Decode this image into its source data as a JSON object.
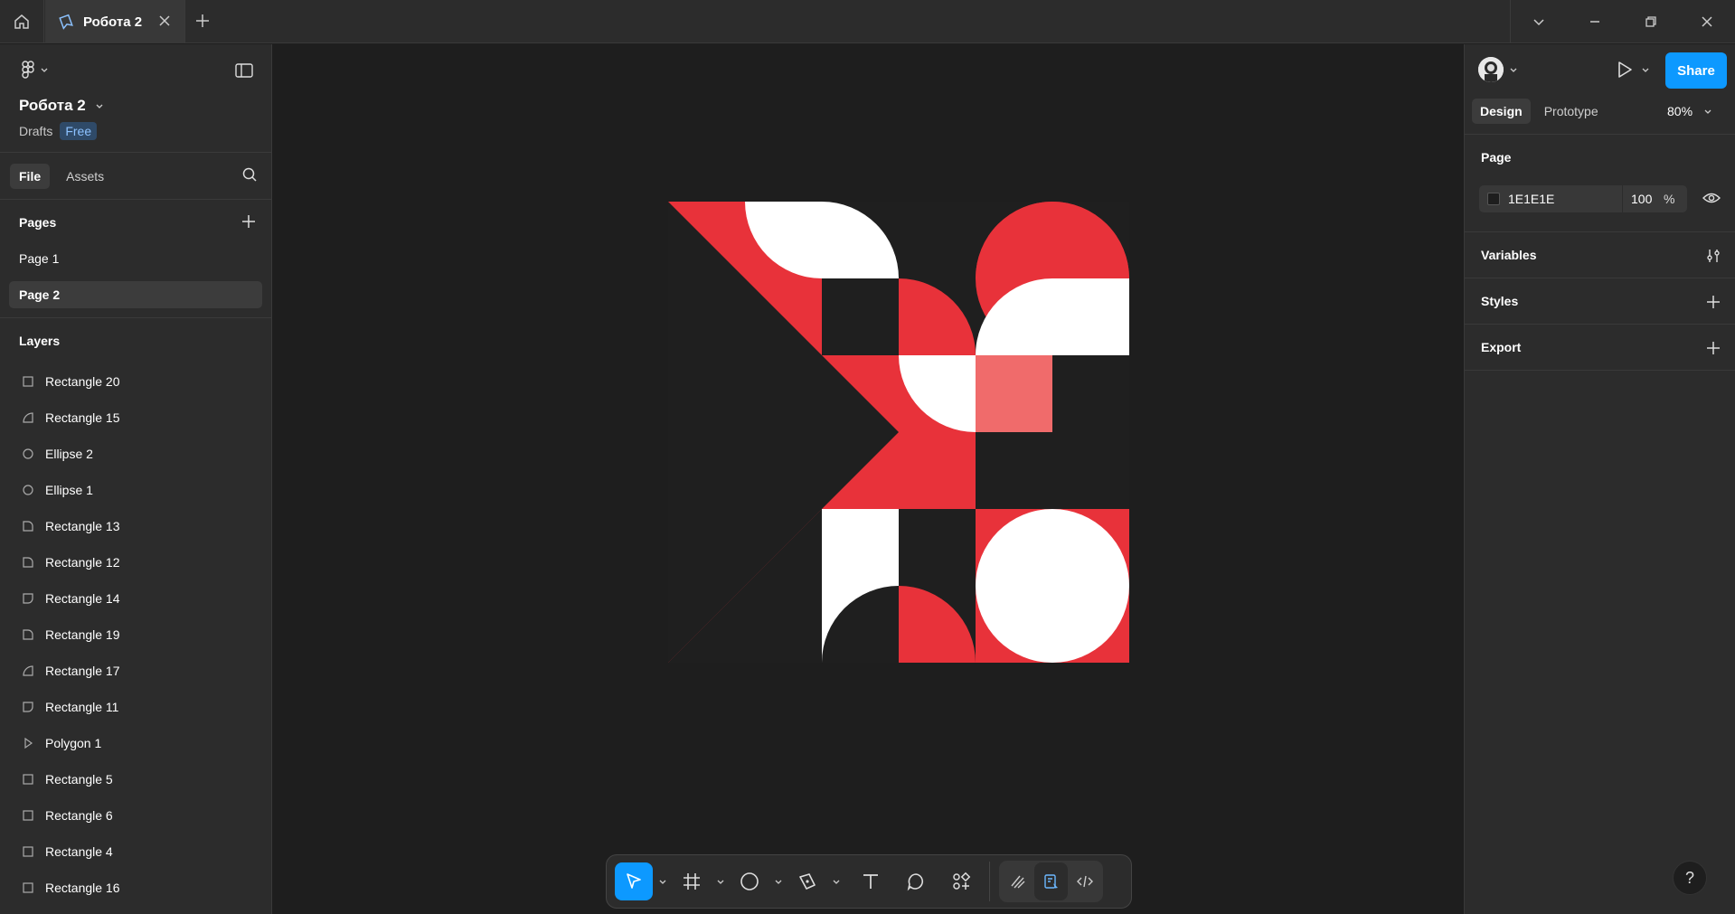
{
  "titlebar": {
    "tab_title": "Робота 2"
  },
  "left_panel": {
    "file_name": "Робота 2",
    "location": "Drafts",
    "plan_badge": "Free",
    "tabs": [
      {
        "label": "File",
        "active": true
      },
      {
        "label": "Assets",
        "active": false
      }
    ],
    "pages_header": "Pages",
    "pages": [
      {
        "label": "Page 1",
        "active": false
      },
      {
        "label": "Page 2",
        "active": true
      }
    ],
    "layers_header": "Layers",
    "layers": [
      {
        "label": "Rectangle 20",
        "icon": "rect-icon"
      },
      {
        "label": "Rectangle 15",
        "icon": "curve-shape-icon"
      },
      {
        "label": "Ellipse 2",
        "icon": "ellipse-icon"
      },
      {
        "label": "Ellipse 1",
        "icon": "ellipse-icon"
      },
      {
        "label": "Rectangle 13",
        "icon": "corner-shape-icon"
      },
      {
        "label": "Rectangle 12",
        "icon": "corner-shape-icon"
      },
      {
        "label": "Rectangle 14",
        "icon": "corner-shape-flipped-icon"
      },
      {
        "label": "Rectangle 19",
        "icon": "corner-shape-icon"
      },
      {
        "label": "Rectangle 17",
        "icon": "curve-shape-icon"
      },
      {
        "label": "Rectangle 11",
        "icon": "corner-shape-flipped-icon"
      },
      {
        "label": "Polygon 1",
        "icon": "triangle-icon"
      },
      {
        "label": "Rectangle 5",
        "icon": "rect-icon"
      },
      {
        "label": "Rectangle 6",
        "icon": "rect-icon"
      },
      {
        "label": "Rectangle 4",
        "icon": "rect-icon"
      },
      {
        "label": "Rectangle 16",
        "icon": "rect-icon"
      }
    ]
  },
  "right_panel": {
    "share_label": "Share",
    "tabs": [
      {
        "label": "Design",
        "active": true
      },
      {
        "label": "Prototype",
        "active": false
      }
    ],
    "zoom": "80%",
    "page_section": {
      "header": "Page",
      "fill_hex": "1E1E1E",
      "opacity": "100",
      "opacity_unit": "%"
    },
    "variables_label": "Variables",
    "styles_label": "Styles",
    "export_label": "Export",
    "help_label": "?"
  },
  "colors": {
    "accent": "#0d99ff",
    "artwork_red": "#e8323a",
    "artwork_light_red": "#f06b6b",
    "artwork_white": "#ffffff",
    "artwork_bg": "#1e1e1e"
  },
  "toolbar": {
    "tools": [
      "move-icon",
      "frame-icon",
      "ellipse-tool-icon",
      "pen-icon",
      "text-icon",
      "comment-icon",
      "actions-icon"
    ],
    "dev_tools": [
      "draw-mode-icon",
      "design-mode-icon",
      "dev-mode-icon"
    ]
  }
}
